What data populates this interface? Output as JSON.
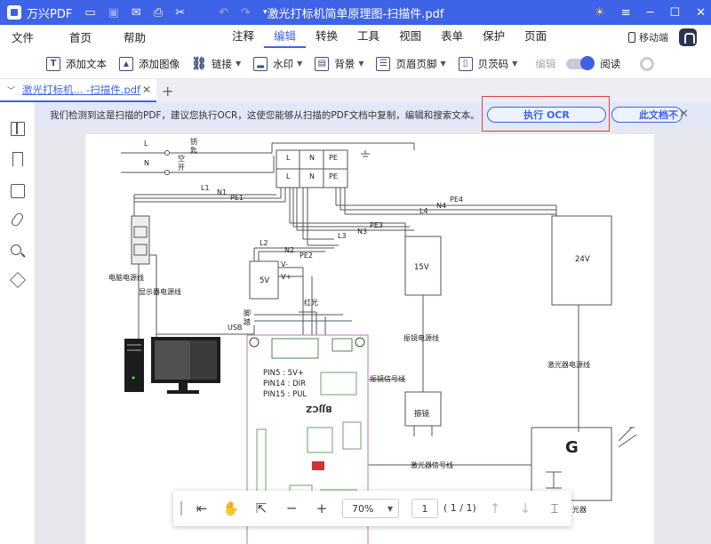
{
  "titlebar": {
    "app_name": "万兴PDF",
    "doc_title": "激光打标机简单原理图-扫描件.pdf",
    "qa_icons": [
      "folder-icon",
      "save-icon",
      "mail-icon",
      "print-icon",
      "scissors-icon",
      "undo-icon",
      "redo-icon",
      "dropdown-icon"
    ],
    "win_icons": [
      "sun-icon",
      "menu-icon",
      "minimize-icon",
      "maximize-icon",
      "close-icon"
    ]
  },
  "menubar": {
    "left": [
      "文件",
      "首页",
      "帮助"
    ],
    "center": [
      "注释",
      "编辑",
      "转换",
      "工具",
      "视图",
      "表单",
      "保护",
      "页面"
    ],
    "active": "编辑",
    "mobile_label": "移动端"
  },
  "toolbar": {
    "add_text": "添加文本",
    "add_image": "添加图像",
    "link": "链接",
    "watermark": "水印",
    "background": "背景",
    "header_footer": "页眉页脚",
    "bates": "贝茨码",
    "edit": "编辑",
    "read": "阅读"
  },
  "tab": {
    "name": "激光打标机... -扫描件.pdf",
    "close_glyph": "✕",
    "new_tab_glyph": "+"
  },
  "ocr_bar": {
    "message": "我们检测到这是扫描的PDF，建议您执行OCR，这使您能够从扫描的PDF文档中复制，编辑和搜索文本。",
    "ocr_button": "执行 OCR",
    "second_button": "此文档不",
    "close_glyph": "✕"
  },
  "schematic": {
    "labels": {
      "L": "L",
      "N": "N",
      "key": "钥",
      "key2": "匙",
      "air": "空",
      "switch": "开",
      "L1": "L1",
      "N1": "N1",
      "PE1": "PE1",
      "PE4": "PE4",
      "N4": "N4",
      "L4": "L4",
      "PE3": "PE3",
      "N3": "N3",
      "L3": "L3",
      "L2": "L2",
      "N2": "N2",
      "PE2": "PE2",
      "tL": "L",
      "tN": "N",
      "tPE": "PE",
      "tL2": "L",
      "tN2": "N",
      "tPE2": "PE",
      "v15": "15V",
      "v24": "24V",
      "v5": "5V",
      "vminus": "V-",
      "vplus": "V+",
      "pc_power": "电脑电源线",
      "monitor_power": "显示器电源线",
      "galvo_power": "振镜电源线",
      "laser_power": "激光器电源线",
      "galvo_signal": "振镜信号线",
      "laser_signal": "激光器信号线",
      "galvo": "振镜",
      "red_light": "红光",
      "foot": "脚",
      "pedal": "踏",
      "usb": "USB",
      "pin5": "PIN5  :  5V+",
      "pin14": "PIN14 :  DIR",
      "pin15": "PIN15 :  PUL",
      "board": "BJJCZ",
      "G": "G",
      "laser_dev": "光器"
    }
  },
  "bottombar": {
    "zoom": "70%",
    "page_input": "1",
    "page_count": "( 1 / 1)"
  }
}
